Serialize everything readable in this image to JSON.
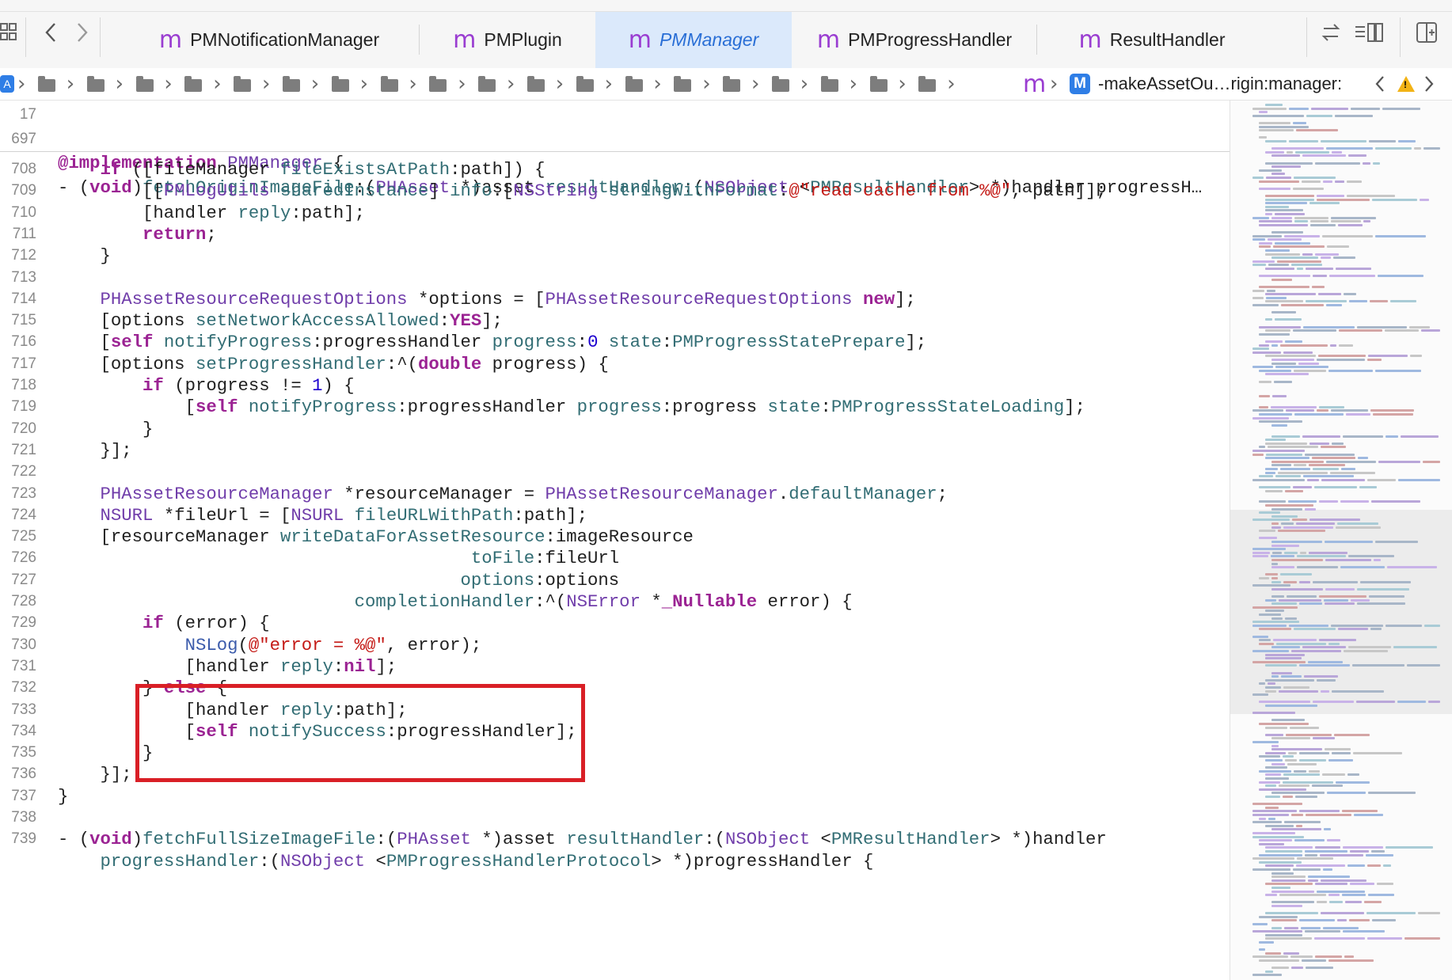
{
  "tabs": [
    {
      "icon": "m",
      "label": "PMNotificationManager",
      "active": false
    },
    {
      "icon": "m",
      "label": "PMPlugin",
      "active": false
    },
    {
      "icon": "m",
      "label": "PMManager",
      "active": true
    },
    {
      "icon": "m",
      "label": "PMProgressHandler",
      "active": false
    },
    {
      "icon": "m",
      "label": "ResultHandler",
      "active": false
    }
  ],
  "toolbar_icons": [
    "grid-icon",
    "back-icon",
    "forward-icon",
    "swap-icon",
    "editor-layout-icon",
    "add-editor-icon"
  ],
  "jumpbar": {
    "folder_count": 19,
    "file_icon": "m",
    "method_badge": "M",
    "method": "-makeAssetOu…rigin:manager:"
  },
  "sticky_header": {
    "line1_num": "17",
    "line1": "@implementation PMManager {",
    "line2_num": "697",
    "line2": "- (void)fetchOriginImageFile:(PHAsset *)asset resultHandler:(NSObject <PMResultHandler> *)handler progressH…"
  },
  "code_lines": [
    {
      "n": "708",
      "t": "    if ([fileManager fileExistsAtPath:path]) {"
    },
    {
      "n": "709",
      "t": "        [[PMLogUtils sharedInstance] info:[NSString stringWithFormat:@\"read cache from %@\", path]];"
    },
    {
      "n": "710",
      "t": "        [handler reply:path];"
    },
    {
      "n": "711",
      "t": "        return;"
    },
    {
      "n": "712",
      "t": "    }"
    },
    {
      "n": "713",
      "t": ""
    },
    {
      "n": "714",
      "t": "    PHAssetResourceRequestOptions *options = [PHAssetResourceRequestOptions new];"
    },
    {
      "n": "715",
      "t": "    [options setNetworkAccessAllowed:YES];"
    },
    {
      "n": "716",
      "t": "    [self notifyProgress:progressHandler progress:0 state:PMProgressStatePrepare];"
    },
    {
      "n": "717",
      "t": "    [options setProgressHandler:^(double progress) {"
    },
    {
      "n": "718",
      "t": "        if (progress != 1) {"
    },
    {
      "n": "719",
      "t": "            [self notifyProgress:progressHandler progress:progress state:PMProgressStateLoading];"
    },
    {
      "n": "720",
      "t": "        }"
    },
    {
      "n": "721",
      "t": "    }];"
    },
    {
      "n": "722",
      "t": ""
    },
    {
      "n": "723",
      "t": "    PHAssetResourceManager *resourceManager = PHAssetResourceManager.defaultManager;"
    },
    {
      "n": "724",
      "t": "    NSURL *fileUrl = [NSURL fileURLWithPath:path];"
    },
    {
      "n": "725",
      "t": "    [resourceManager writeDataForAssetResource:imageResource"
    },
    {
      "n": "726",
      "t": "                                       toFile:fileUrl"
    },
    {
      "n": "727",
      "t": "                                      options:options"
    },
    {
      "n": "728",
      "t": "                            completionHandler:^(NSError *_Nullable error) {"
    },
    {
      "n": "729",
      "t": "        if (error) {"
    },
    {
      "n": "730",
      "t": "            NSLog(@\"error = %@\", error);"
    },
    {
      "n": "731",
      "t": "            [handler reply:nil];"
    },
    {
      "n": "732",
      "t": "        } else {"
    },
    {
      "n": "733",
      "t": "            [handler reply:path];"
    },
    {
      "n": "734",
      "t": "            [self notifySuccess:progressHandler];"
    },
    {
      "n": "735",
      "t": "        }"
    },
    {
      "n": "736",
      "t": "    }];"
    },
    {
      "n": "737",
      "t": "}"
    },
    {
      "n": "738",
      "t": ""
    },
    {
      "n": "739",
      "t": "- (void)fetchFullSizeImageFile:(PHAsset *)asset resultHandler:(NSObject <PMResultHandler> *)handler"
    },
    {
      "n": "",
      "t": "    progressHandler:(NSObject <PMProgressHandlerProtocol> *)progressHandler {"
    }
  ],
  "colors": {
    "keyword": "#9b2393",
    "type": "#3b5bab",
    "method": "#326d74",
    "string": "#c41a16",
    "number": "#1c00cf",
    "highlight_box": "#d91f26",
    "active_tab_bg": "#dbe9fb",
    "accent": "#2a6fd6"
  }
}
